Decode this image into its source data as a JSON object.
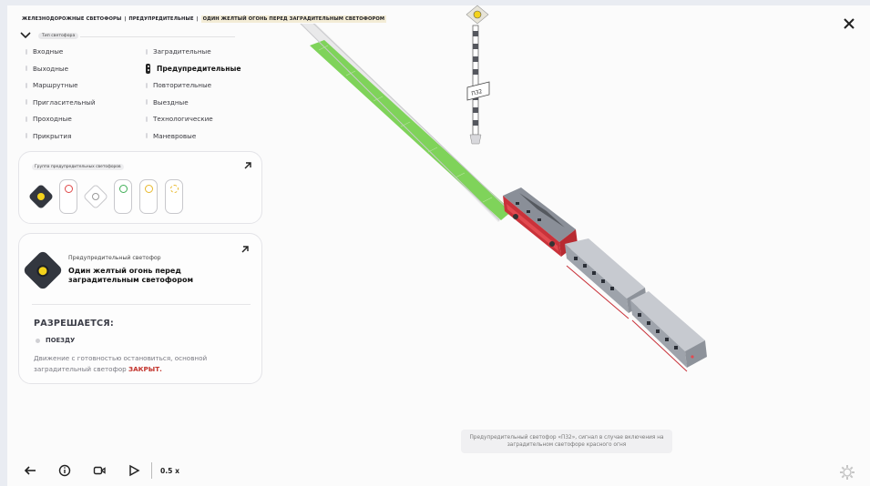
{
  "breadcrumb": {
    "items": [
      "ЖЕЛЕЗНОДОРОЖНЫЕ СВЕТОФОРЫ",
      "ПРЕДУПРЕДИТЕЛЬНЫЕ",
      "ОДИН ЖЕЛТЫЙ ОГОНЬ ПЕРЕД ЗАГРАДИТЕЛЬНЫМ СВЕТОФОРОМ"
    ],
    "separator": "|"
  },
  "filter": {
    "label": "Тип светофора"
  },
  "types": {
    "left": [
      "Входные",
      "Выходные",
      "Маршрутные",
      "Пригласительный",
      "Проходные",
      "Прикрытия"
    ],
    "right": [
      "Заградительные",
      "Предупредительные",
      "Повторительные",
      "Выездные",
      "Технологические",
      "Маневровые"
    ],
    "active": "Предупредительные"
  },
  "group_card": {
    "title": "Группа предупредительных светофоров",
    "signals": [
      {
        "shape": "diamond",
        "color": "#f3d21c",
        "selected": true
      },
      {
        "shape": "pill",
        "color": "#e04848"
      },
      {
        "shape": "diamond",
        "color": "#9a9a9a",
        "selected": false
      },
      {
        "shape": "pill",
        "color": "#3fae56"
      },
      {
        "shape": "pill",
        "color": "#e8b82a"
      },
      {
        "shape": "pill",
        "color": "#e8b82a"
      }
    ]
  },
  "info_card": {
    "subtitle": "Предупредительный светофор",
    "title": "Один желтый огонь перед заградительным светофором",
    "allowed_heading": "РАЗРЕШАЕТСЯ:",
    "allowed_item": "ПОЕЗДУ",
    "description": "Движение с готовностью остановиться, основной заградительный светофор",
    "description_red": "ЗАКРЫТ."
  },
  "scene": {
    "sign_label": "П32",
    "caption": "Предупредительный светофор «П32», сигнал в случае включения на заградительном светофоре красного огня"
  },
  "controls": {
    "speed": "0.5 x"
  },
  "colors": {
    "accent_yellow": "#f3d21c",
    "track_green": "#7fd35a",
    "loco_red": "#c9323a",
    "loco_grey": "#8a8f98",
    "text_red": "#c3342d"
  },
  "icons": [
    "close-icon",
    "chevron-down-icon",
    "arrow-up-right-icon",
    "back-arrow-icon",
    "info-icon",
    "camera-icon",
    "play-icon",
    "settings-gear-icon"
  ]
}
